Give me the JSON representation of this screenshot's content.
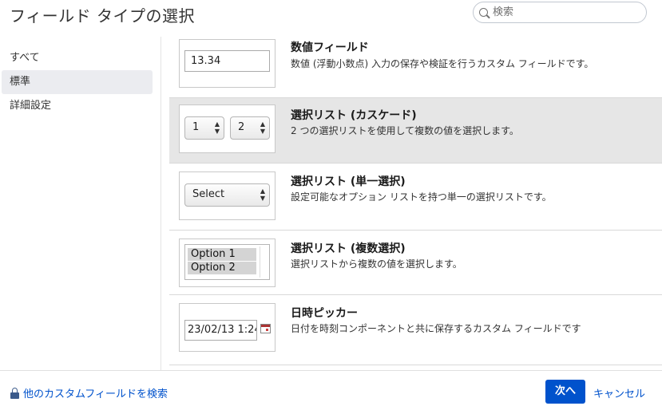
{
  "header": {
    "title": "フィールド タイプの選択",
    "search_placeholder": "検索"
  },
  "sidebar": {
    "items": [
      {
        "label": "すべて"
      },
      {
        "label": "標準"
      },
      {
        "label": "詳細設定"
      }
    ]
  },
  "fields": [
    {
      "title": "数値フィールド",
      "description": "数値 (浮動小数点) 入力の保存や検証を行うカスタム フィールドです。",
      "preview_value": "13.34"
    },
    {
      "title": "選択リスト (カスケード)",
      "description": "2 つの選択リストを使用して複数の値を選択します。",
      "preview_select_1": "1",
      "preview_select_2": "2"
    },
    {
      "title": "選択リスト (単一選択)",
      "description": "設定可能なオプション リストを持つ単一の選択リストです。",
      "preview_select": "Select"
    },
    {
      "title": "選択リスト (複数選択)",
      "description": "選択リストから複数の値を選択します。",
      "preview_options": [
        "Option 1",
        "Option 2"
      ]
    },
    {
      "title": "日時ピッカー",
      "description": "日付を時刻コンポーネントと共に保存するカスタム フィールドです",
      "preview_value": "23/02/13 1:24"
    }
  ],
  "footer": {
    "search_link": "他のカスタムフィールドを検索",
    "next_label": "次へ",
    "cancel_label": "キャンセル"
  }
}
